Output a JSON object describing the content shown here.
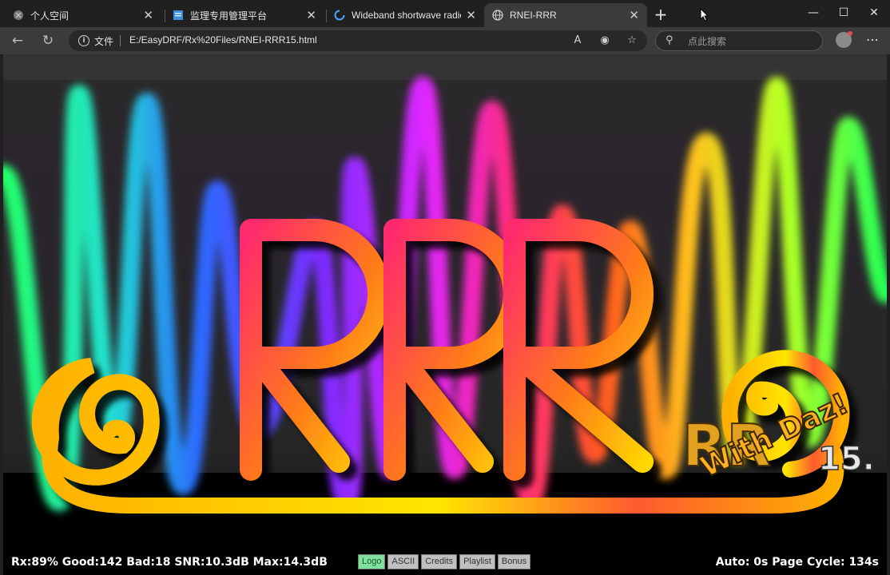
{
  "tabs": [
    {
      "title": "个人空间",
      "icon": "globe-gray-icon",
      "active": false
    },
    {
      "title": "监理专用管理平台",
      "icon": "blue-doc-icon",
      "active": false
    },
    {
      "title": "Wideband shortwave radio receiv",
      "icon": "loading-spinner-icon",
      "active": false
    },
    {
      "title": "RNEI-RRR",
      "icon": "globe-icon",
      "active": true
    }
  ],
  "toolbar": {
    "security_chip": "文件",
    "url": "E:/EasyDRF/Rx%20Files/RNEI-RRR15.html",
    "search_placeholder": "点此搜索"
  },
  "page": {
    "logo_text": "RRR",
    "badge_text": "With Daz!",
    "badge_version": "15.",
    "status_left": "Rx:89% Good:142 Bad:18 SNR:10.3dB Max:14.3dB",
    "status_right": "Auto: 0s Page Cycle: 134s",
    "mode_buttons": [
      {
        "label": "Logo",
        "active": true
      },
      {
        "label": "ASCII",
        "active": false
      },
      {
        "label": "Credits",
        "active": false
      },
      {
        "label": "Playlist",
        "active": false
      },
      {
        "label": "Bonus",
        "active": false
      }
    ]
  },
  "colors": {
    "chrome_bg": "#202020",
    "toolbar_bg": "#3b3b3b",
    "page_bg": "#000000",
    "logo_gradient": [
      "#ff2a6d",
      "#ff6a00",
      "#ffd800"
    ],
    "active_button": "#7fe0a0"
  }
}
